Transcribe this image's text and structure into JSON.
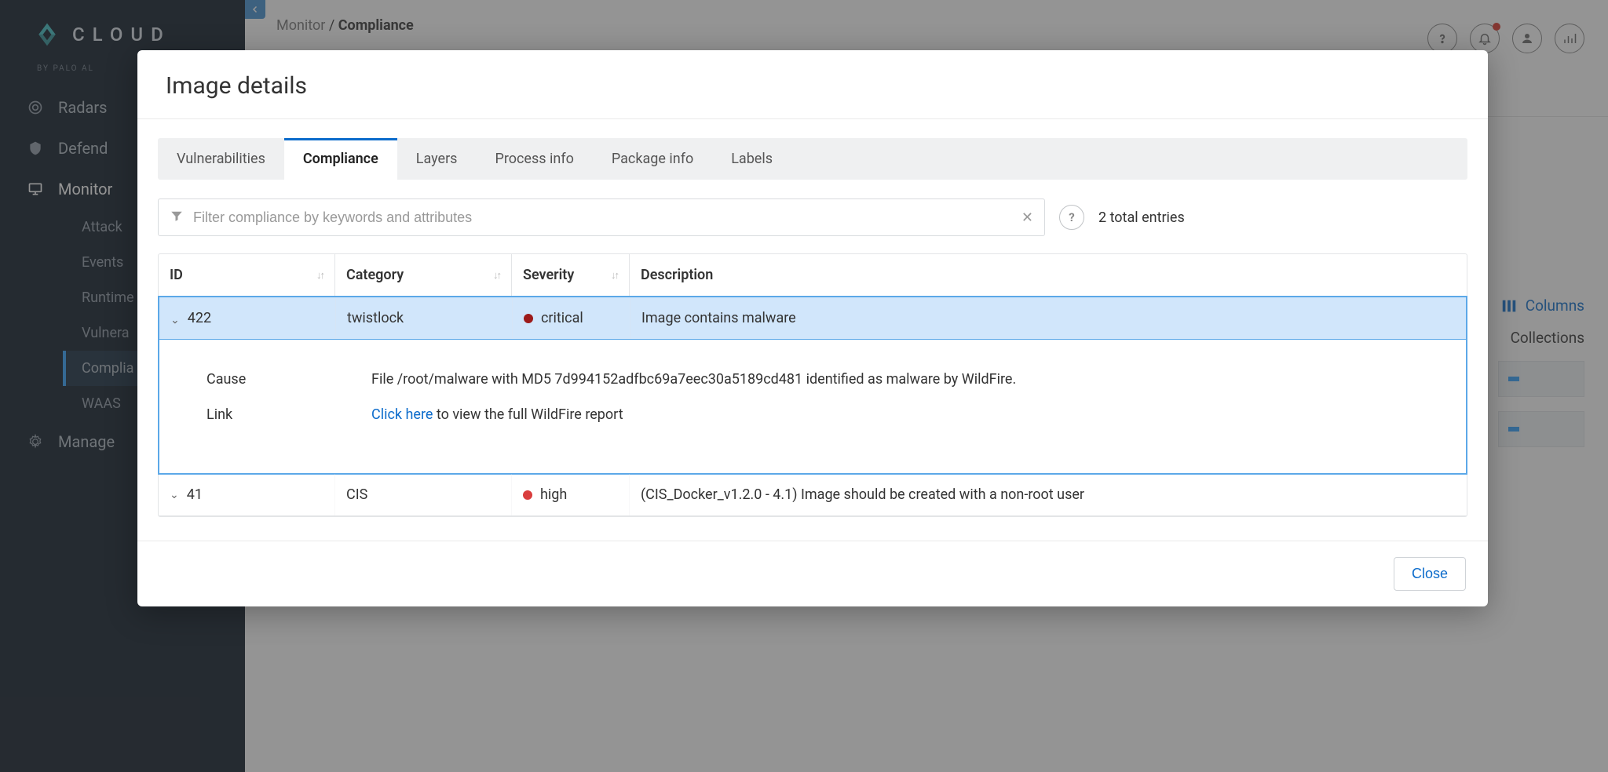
{
  "brand": {
    "name": "CLOUD",
    "sub": "BY PALO AL"
  },
  "sidebar": {
    "items": [
      {
        "label": "Radars",
        "icon": "radar-icon"
      },
      {
        "label": "Defend",
        "icon": "shield-icon"
      },
      {
        "label": "Monitor",
        "icon": "monitor-icon",
        "active": true
      },
      {
        "label": "Manage",
        "icon": "gear-icon"
      }
    ],
    "monitor_sub": [
      {
        "label": "Attack"
      },
      {
        "label": "Events"
      },
      {
        "label": "Runtime"
      },
      {
        "label": "Vulnera"
      },
      {
        "label": "Complia",
        "selected": true
      },
      {
        "label": "WAAS"
      }
    ]
  },
  "breadcrumb": {
    "parent": "Monitor",
    "current": "Compliance"
  },
  "side_buttons": {
    "columns": "Columns",
    "collections": "Collections"
  },
  "modal": {
    "title": "Image details",
    "tabs": [
      {
        "label": "Vulnerabilities"
      },
      {
        "label": "Compliance",
        "active": true
      },
      {
        "label": "Layers"
      },
      {
        "label": "Process info"
      },
      {
        "label": "Package info"
      },
      {
        "label": "Labels"
      }
    ],
    "filter_placeholder": "Filter compliance by keywords and attributes",
    "entries_text": "2 total entries",
    "columns": {
      "id": "ID",
      "category": "Category",
      "severity": "Severity",
      "description": "Description"
    },
    "rows": [
      {
        "id": "422",
        "category": "twistlock",
        "severity": "critical",
        "description": "Image contains malware",
        "expanded": true,
        "detail": {
          "cause_label": "Cause",
          "cause_value": "File /root/malware with MD5 7d994152adfbc69a7eec30a5189cd481 identified as malware by WildFire.",
          "link_label": "Link",
          "link_text": "Click here",
          "link_rest": " to view the full WildFire report"
        }
      },
      {
        "id": "41",
        "category": "CIS",
        "severity": "high",
        "description": "(CIS_Docker_v1.2.0 - 4.1) Image should be created with a non-root user",
        "expanded": false
      }
    ],
    "close_label": "Close"
  }
}
